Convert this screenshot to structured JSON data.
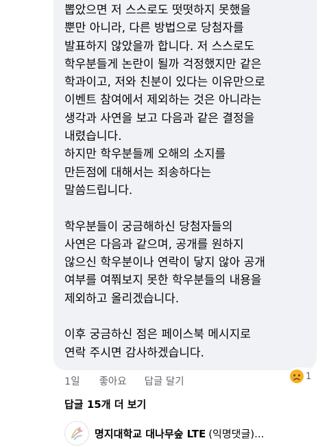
{
  "comment": {
    "lines": [
      "뽑았으면 저 스스로도 떳떳하지 못했을",
      "뿐만 아니라, 다른 방법으로 당첨자를",
      "발표하지 않았을까 합니다. 저 스스로도",
      "학우분들게 논란이 될까 걱정했지만 같은",
      "학과이고, 저와 친분이 있다는 이유만으로",
      "이벤트 참여에서 제외하는 것은 아니라는",
      "생각과 사연을 보고 다음과 같은 결정을",
      "내렸습니다.",
      "하지만 학우분들께 오해의 소지를",
      "만든점에 대해서는 죄송하다는",
      "말씀드립니다.",
      "",
      "학우분들이 궁금해하신 당첨자들의",
      "사연은 다음과 같으며, 공개를 원하지",
      "않으신 학우분이나 연락이 닿지 않아 공개",
      "여부를 여쭤보지 못한 학우분들의 내용을",
      "제외하고 올리겠습니다.",
      "",
      "이후 궁금하신 점은 페이스북 메시지로",
      "연락 주시면 감사하겠습니다."
    ]
  },
  "meta": {
    "time": "1일",
    "like_label": "좋아요",
    "reply_label": "답글 달기"
  },
  "reaction": {
    "icon": "sad-face-icon",
    "count": "1",
    "color": "#f7b125"
  },
  "more_replies": "답글 15개 더 보기",
  "reply": {
    "name": "명지대학교 대나무숲 LTE",
    "tag": "(익명댓글)..."
  }
}
